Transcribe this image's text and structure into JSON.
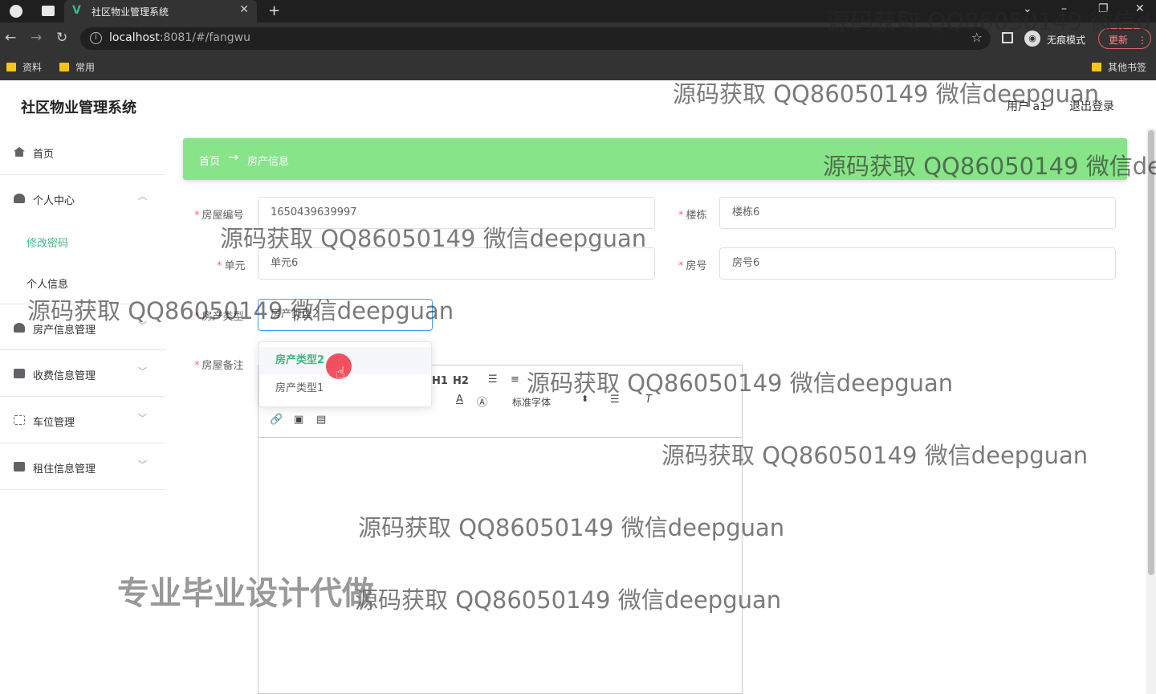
{
  "browser": {
    "tab_title": "社区物业管理系统",
    "url_host": "localhost",
    "url_rest": ":8081/#/fangwu",
    "incognito_label": "无痕模式",
    "update_label": "更新",
    "bookmarks": [
      "资料",
      "常用"
    ],
    "other_bookmarks": "其他书签"
  },
  "app": {
    "title": "社区物业管理系统",
    "user_label": "用户 a1",
    "logout_label": "退出登录"
  },
  "sidebar": {
    "home": "首页",
    "personal_center": "个人中心",
    "change_password": "修改密码",
    "personal_info": "个人信息",
    "property_mgmt": "房产信息管理",
    "fee_mgmt": "收费信息管理",
    "parking_mgmt": "车位管理",
    "rental_mgmt": "租住信息管理"
  },
  "breadcrumb": {
    "home": "首页",
    "current": "房产信息"
  },
  "form": {
    "house_no_label": "房屋编号",
    "house_no_value": "1650439639997",
    "building_label": "楼栋",
    "building_value": "楼栋6",
    "unit_label": "单元",
    "unit_value": "单元6",
    "room_label": "房号",
    "room_value": "房号6",
    "type_label": "房产类型",
    "type_value": "房产类型2",
    "remark_label": "房屋备注"
  },
  "dropdown": {
    "options": [
      "房产类型2",
      "房产类型1"
    ]
  },
  "editor": {
    "h1": "H1",
    "h2": "H2",
    "font_select": "标准字体"
  },
  "watermarks": {
    "text": "源码获取 QQ86050149 微信deepguan",
    "text_cut1": "源码获取 QQ86050149 微信d",
    "text_cut2": "源码获取 QQ86050149 微信de",
    "big": "专业毕业设计代做"
  },
  "colors": {
    "breadcrumb_bg": "#88e488",
    "accent_green": "#41b883",
    "required_red": "#f56c6c"
  }
}
